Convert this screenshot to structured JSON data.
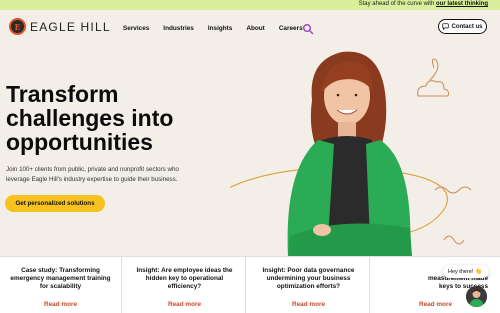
{
  "topbar": {
    "lead": "Stay ahead of the curve with",
    "link": "our latest thinking"
  },
  "logo": {
    "mark": "E",
    "text": "EAGLE HILL"
  },
  "nav": {
    "items": [
      "Services",
      "Industries",
      "Insights",
      "About",
      "Careers"
    ]
  },
  "contact": {
    "label": "Contact us",
    "icon": "chat-bubble-icon"
  },
  "hero": {
    "title_lines": [
      "Transform",
      "challenges into",
      "opportunities"
    ],
    "subtitle_lines": [
      "Join 100+ clients from public, private and nonprofit sectors who",
      "leverage Eagle Hill's industry expertise to guide their business."
    ],
    "cta": "Get personalized solutions"
  },
  "cards": [
    {
      "title_lines": [
        "Case study: Transforming",
        "emergency management training",
        "for scalability"
      ],
      "link": "Read more"
    },
    {
      "title_lines": [
        "Insight: Are employee ideas the",
        "hidden key to operational",
        "efficiency?"
      ],
      "link": "Read more"
    },
    {
      "title_lines": [
        "Insight: Poor data governance",
        "undermining your business",
        "optimization efforts?"
      ],
      "link": "Read more"
    },
    {
      "title_lines": [
        "Insight: Perfo",
        "measurement made",
        "keys to success"
      ],
      "link": "Read more"
    }
  ],
  "chat": {
    "greeting": "Hey there!",
    "emoji": "👋"
  },
  "colors": {
    "topbar": "#d9ef9a",
    "accent": "#c8492a",
    "cta": "#f7c21f",
    "background": "#f3efe8",
    "sweater": "#2bab55"
  }
}
